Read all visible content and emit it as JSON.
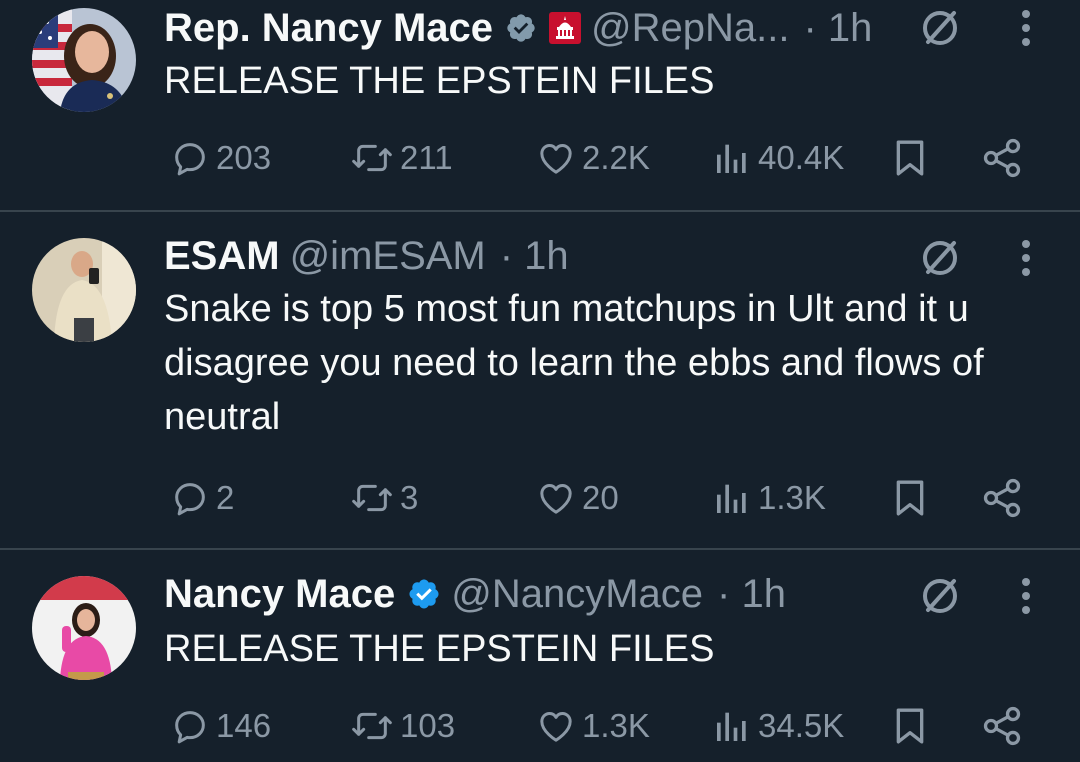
{
  "tweets": [
    {
      "name": "Rep. Nancy Mace",
      "handle": "@RepNa...",
      "time": "· 1h",
      "verified": "grey-check",
      "affiliation": "us-house-capitol-icon",
      "text": "RELEASE THE EPSTEIN FILES",
      "replies": "203",
      "reposts": "211",
      "likes": "2.2K",
      "views": "40.4K"
    },
    {
      "name": "ESAM",
      "handle": "@imESAM",
      "time": "· 1h",
      "text": "Snake is top 5 most fun matchups in Ult and it u disagree you need to learn the ebbs and flows of neutral",
      "replies": "2",
      "reposts": "3",
      "likes": "20",
      "views": "1.3K"
    },
    {
      "name": "Nancy Mace",
      "handle": "@NancyMace",
      "time": "· 1h",
      "verified": "blue-check",
      "text": "RELEASE THE EPSTEIN FILES",
      "replies": "146",
      "reposts": "103",
      "likes": "1.3K",
      "views": "34.5K"
    }
  ],
  "colors": {
    "background": "#15202b",
    "divider": "#38444d",
    "text": "#f7f9f9",
    "muted": "#8b98a5",
    "blue_check": "#1d9bf0",
    "grey_check": "#829aab",
    "house_red": "#c8102e"
  }
}
